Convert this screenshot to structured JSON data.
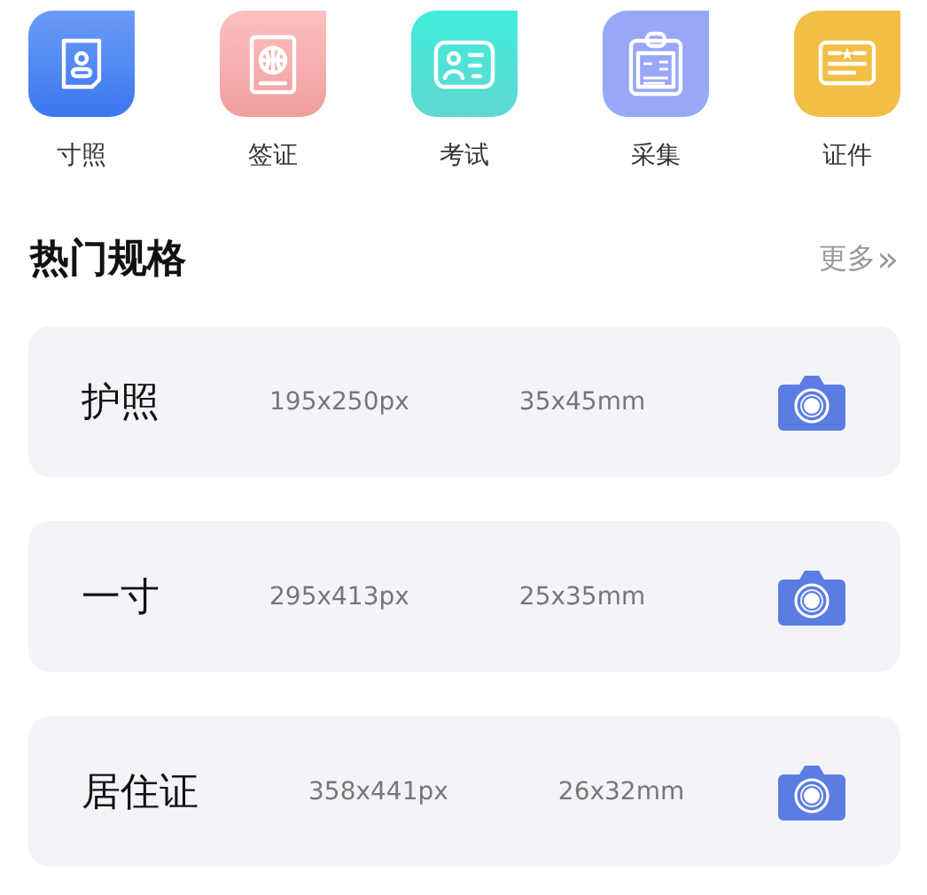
{
  "categories": [
    {
      "label": "寸照"
    },
    {
      "label": "签证"
    },
    {
      "label": "考试"
    },
    {
      "label": "采集"
    },
    {
      "label": "证件"
    }
  ],
  "section": {
    "title": "热门规格",
    "more": "更多",
    "more_icon": "»"
  },
  "specs": [
    {
      "name": "护照",
      "pixels": "195x250px",
      "size": "35x45mm"
    },
    {
      "name": "一寸",
      "pixels": "295x413px",
      "size": "25x35mm"
    },
    {
      "name": "居住证",
      "pixels": "358x441px",
      "size": "26x32mm"
    }
  ]
}
